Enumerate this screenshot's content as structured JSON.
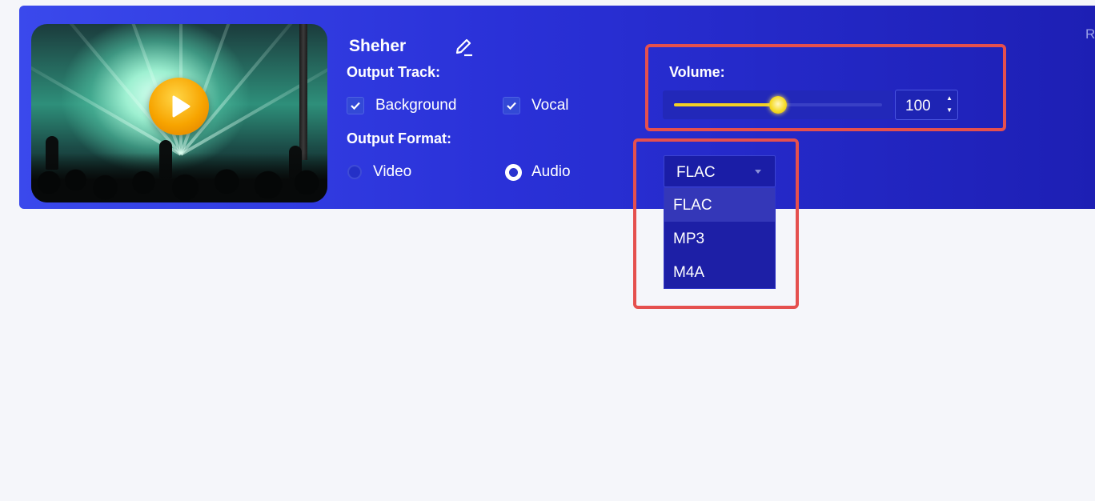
{
  "media": {
    "title": "Sheher",
    "clipped_text": "R"
  },
  "output_track": {
    "label": "Output Track:",
    "options": [
      {
        "label": "Background",
        "checked": true
      },
      {
        "label": "Vocal",
        "checked": true
      }
    ]
  },
  "output_format": {
    "label": "Output Format:",
    "options": [
      {
        "label": "Video",
        "selected": false
      },
      {
        "label": "Audio",
        "selected": true
      }
    ],
    "selected_format": "FLAC",
    "dropdown_options": [
      "FLAC",
      "MP3",
      "M4A"
    ],
    "highlighted_option": "FLAC"
  },
  "volume": {
    "label": "Volume:",
    "value": "100",
    "slider_level": 0.5
  },
  "colors": {
    "accent": "#2a31d8",
    "slider": "#f3d024",
    "highlight_box": "#e5504e",
    "play_button": "#f7a400"
  },
  "icons": [
    "play-icon",
    "edit-icon",
    "check-icon",
    "caret-down-icon",
    "spin-up-icon",
    "spin-down-icon"
  ]
}
